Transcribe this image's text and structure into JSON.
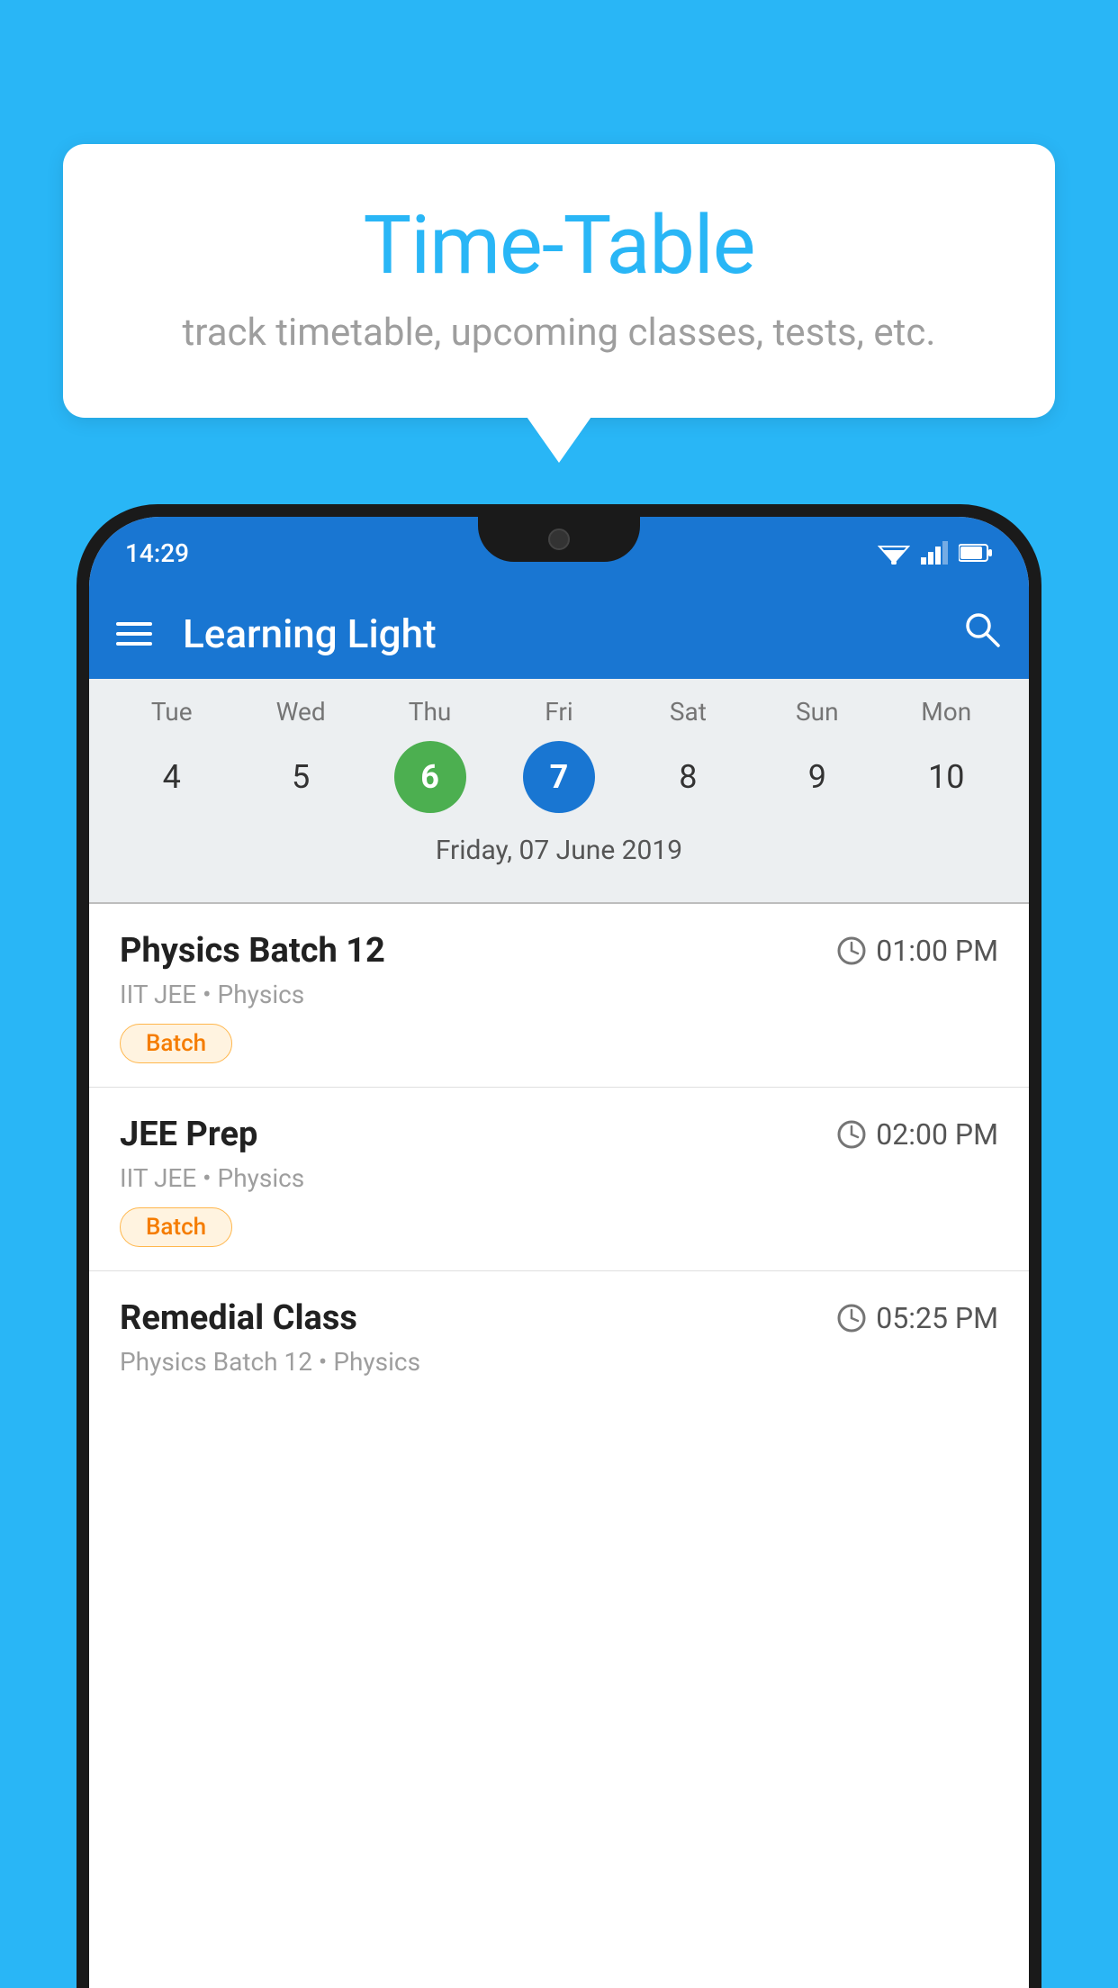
{
  "background_color": "#29B6F6",
  "bubble": {
    "title": "Time-Table",
    "subtitle": "track timetable, upcoming classes, tests, etc."
  },
  "status_bar": {
    "time": "14:29"
  },
  "app_bar": {
    "title": "Learning Light"
  },
  "calendar": {
    "days": [
      {
        "label": "Tue",
        "num": "4"
      },
      {
        "label": "Wed",
        "num": "5"
      },
      {
        "label": "Thu",
        "num": "6",
        "state": "today"
      },
      {
        "label": "Fri",
        "num": "7",
        "state": "selected"
      },
      {
        "label": "Sat",
        "num": "8"
      },
      {
        "label": "Sun",
        "num": "9"
      },
      {
        "label": "Mon",
        "num": "10"
      }
    ],
    "selected_date": "Friday, 07 June 2019"
  },
  "schedule_items": [
    {
      "name": "Physics Batch 12",
      "time": "01:00 PM",
      "sub": "IIT JEE • Physics",
      "badge": "Batch"
    },
    {
      "name": "JEE Prep",
      "time": "02:00 PM",
      "sub": "IIT JEE • Physics",
      "badge": "Batch"
    },
    {
      "name": "Remedial Class",
      "time": "05:25 PM",
      "sub": "Physics Batch 12 • Physics",
      "badge": null
    }
  ],
  "labels": {
    "menu_icon": "☰",
    "search_icon": "⌕"
  }
}
